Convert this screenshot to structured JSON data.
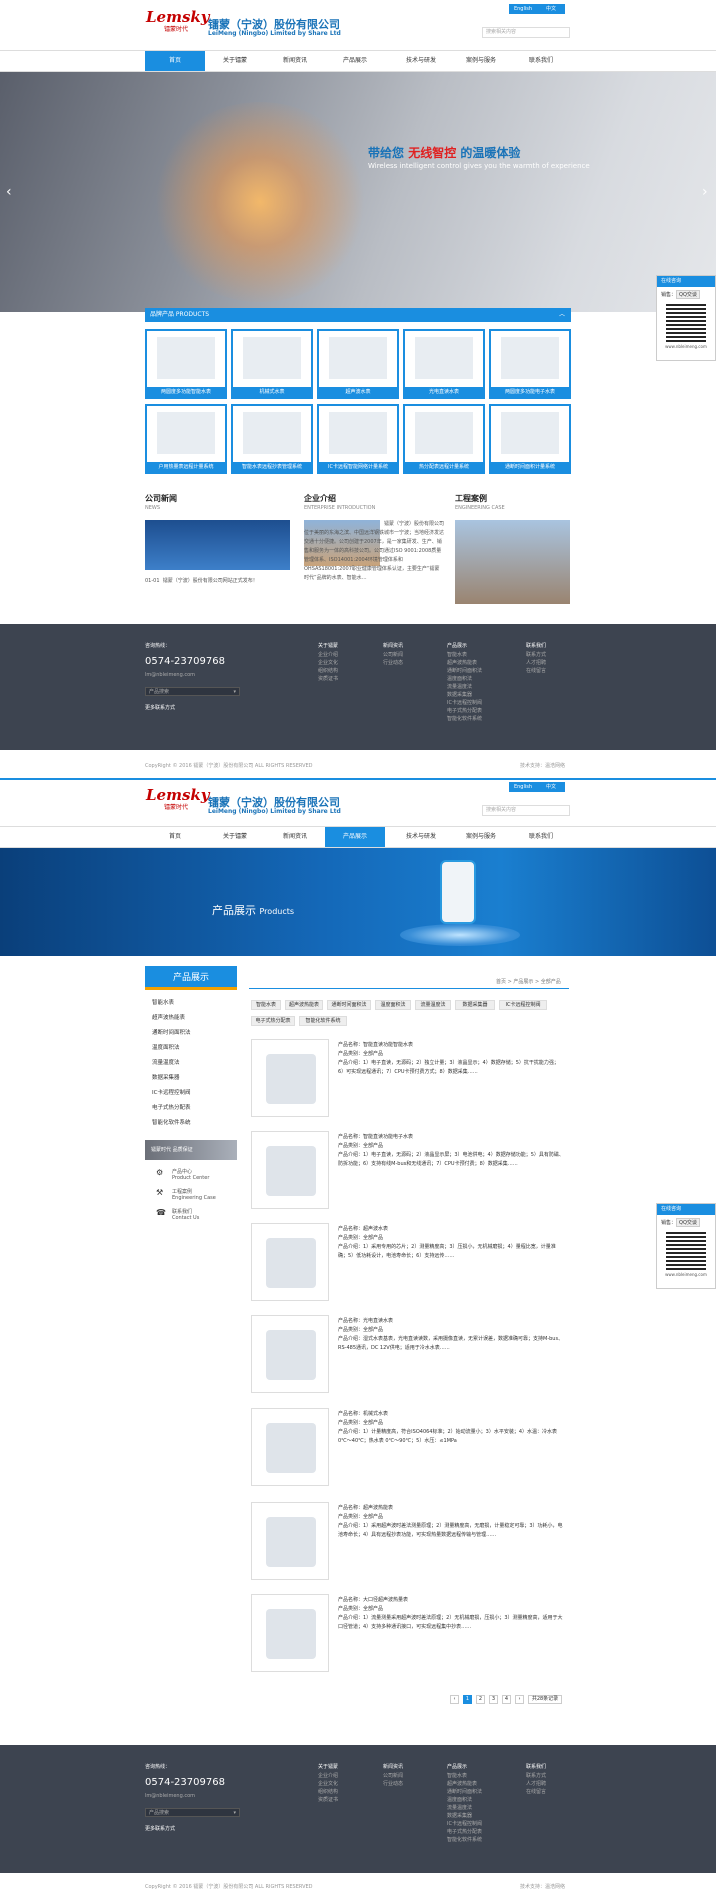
{
  "brand": {
    "logo": "Lemsky",
    "logo_sub": "镭蒙时代",
    "company_cn": "镭蒙（宁波）股份有限公司",
    "company_en": "LeiMeng (Ningbo) Limited by Share Ltd"
  },
  "lang": {
    "en": "English",
    "cn": "中文"
  },
  "search": {
    "placeholder": "搜索相关内容"
  },
  "nav": [
    "首页",
    "关于镭蒙",
    "新闻资讯",
    "产品展示",
    "技术与研发",
    "案例与服务",
    "联系我们"
  ],
  "banner": {
    "slogan_pre": "带给您 ",
    "slogan_red": "无线智控",
    "slogan_post": " 的温暖体验",
    "slogan_en": "Wireless intelligent control gives you the warmth of experience"
  },
  "products_bar": {
    "label": "品牌产品  PRODUCTS"
  },
  "products": [
    "两圆度多功能智能水表",
    "机械式水表",
    "超声波水表",
    "光电直读水表",
    "两圆度多功能电子水表",
    "户用热量表远程计量系统",
    "智能水表远程抄表管理系统",
    "IC卡远程智能网络计量系统",
    "热分配表远程计量系统",
    "通断时间面积计量系统"
  ],
  "news": {
    "title": "公司新闻",
    "sub": "NEWS",
    "item_date": "01-01",
    "item_text": "镭蒙（宁波）股份有限公司网站正式发布！"
  },
  "about": {
    "title": "企业介绍",
    "sub": "ENTERPRISE INTRODUCTION",
    "text": "镭蒙（宁波）股份有限公司位于美丽的东海之滨、中国远洋钢铁城市一宁波；当地经济发达交通十分便捷。公司创建于2007年，是一家集研发、生产、销售和服务为一体的高科技公司。公司通过ISO 9001:2008质量管理体系、ISO14001:2004环境管理体系和OHSAS18001:2007职业健康管理体系认证，主要生产“镭蒙时代”品牌的水表、智能水…"
  },
  "cases": {
    "title": "工程案例",
    "sub": "ENGINEERING CASE"
  },
  "footer": {
    "hotline_label": "咨询热线：",
    "phone": "0574-23709768",
    "email": "lm@nbleimeng.com",
    "select": "产品搜索",
    "more": "更多联系方式",
    "cols": [
      {
        "title": "关于镭蒙",
        "items": [
          "企业介绍",
          "企业文化",
          "组织结构",
          "资质证书"
        ]
      },
      {
        "title": "新闻资讯",
        "items": [
          "公司新闻",
          "行业动态"
        ]
      },
      {
        "title": "产品展示",
        "items": [
          "智能水表",
          "超声波热能表",
          "通断时间面积法",
          "温度面积法",
          "流量温度法",
          "数据采集器",
          "IC卡远程控制阀",
          "电子式热分配表",
          "智能化软件系统"
        ]
      },
      {
        "title": "联系我们",
        "items": [
          "联系方式",
          "人才招聘",
          "在线留言"
        ]
      }
    ],
    "copyright": "CopyRight © 2016 镭蒙（宁波）股份有限公司 ALL RIGHTS RESERVED",
    "support": "技术支持：温浩网络"
  },
  "qq": {
    "head": "在线咨询",
    "label": "销售：",
    "btn": "QQ交谈",
    "url": "www.nbleimeng.com"
  },
  "page2": {
    "banner_title": "产品展示",
    "banner_en": "Products",
    "side_title": "产品展示",
    "side_items": [
      "智能水表",
      "超声波热能表",
      "通断时间面积法",
      "温度面积法",
      "流量温度法",
      "数据采集器",
      "IC卡远程控制阀",
      "电子式热分配表",
      "智能化软件系统"
    ],
    "side_links": [
      {
        "cn": "产品中心",
        "en": "Product Center"
      },
      {
        "cn": "工程案例",
        "en": "Engineering Case"
      },
      {
        "cn": "联系我们",
        "en": "Contact Us"
      }
    ],
    "side_banner": "镭蒙时代 品质保证",
    "crumb": "首页 > 产品展示 > 全部产品",
    "tags": [
      "智能水表",
      "超声波热能表",
      "通断时间面积法",
      "温度面积法",
      "流量温度法",
      "数据采集器",
      "IC卡远程控制阀",
      "电子式热分配表",
      "智能化软件系统"
    ],
    "list": [
      {
        "name": "产品名称：智能直读功能智能水表",
        "cat": "产品类别：全部产品",
        "desc": "产品介绍：1）电子直读，无源码；2）独立计量；3）液晶显示；4）数据存储；5）抗干扰能力强；6）可实现远程通讯；7）CPU卡预付费方式；8）数据采集……"
      },
      {
        "name": "产品名称：智能直读功能电子水表",
        "cat": "产品类别：全部产品",
        "desc": "产品介绍：1）电子直读，无源码；2）液晶显示屏；3）电池供电；4）数据存储功能；5）具有防磁、防拆功能；6）支持有线M-bus和无线通讯；7）CPU卡预付费；8）数据采集……"
      },
      {
        "name": "产品名称：超声波水表",
        "cat": "产品类别：全部产品",
        "desc": "产品介绍：1）采用专用的芯片；2）测量精度高；3）压损小，无机械磨损；4）量程比宽，计量准确；5）低功耗设计，电池寿命长；6）支持远传……"
      },
      {
        "name": "产品名称：光电直读水表",
        "cat": "产品类别：全部产品",
        "desc": "产品介绍：湿式水表基表，光电直读读数，采用摄像直读，无累计误差，数据准确可靠；支持M-bus、RS-485通讯，DC 12V供电；适用于冷水水表……"
      },
      {
        "name": "产品名称：机械式水表",
        "cat": "产品类别：全部产品",
        "desc": "产品介绍：1）计量精度高，符合ISO4064标准；2）始动流量小；3）水平安装；4）水温：冷水表 0℃～40℃；热水表 0℃～90℃；5）水压：≤1MPa"
      },
      {
        "name": "产品名称：超声波热能表",
        "cat": "产品类别：全部产品",
        "desc": "产品介绍：1）采用超声波时差法测量原理；2）测量精度高，无磨损，计量稳定可靠；3）功耗小，电池寿命长；4）具有远程抄表功能，可实现热量数据远程传输与管理……"
      },
      {
        "name": "产品名称：大口径超声波热量表",
        "cat": "产品类别：全部产品",
        "desc": "产品介绍：1）流量测量采用超声波时差法原理；2）无机械磨损，压损小；3）测量精度高，适用于大口径管道；4）支持多种通讯接口，可实现远程集中抄表……"
      }
    ],
    "pages": [
      "1",
      "2",
      "3",
      "4"
    ],
    "page_total": "共28条记录"
  }
}
